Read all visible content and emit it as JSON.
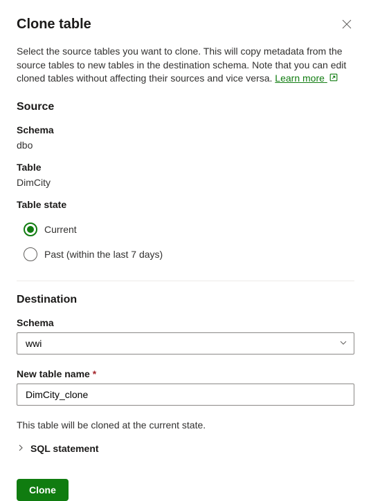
{
  "dialog": {
    "title": "Clone table",
    "description_prefix": "Select the source tables you want to clone. This will copy metadata from the source tables to new tables in the destination schema. Note that you can edit cloned tables without affecting their sources and vice versa. ",
    "learn_more": "Learn more"
  },
  "source": {
    "heading": "Source",
    "schema_label": "Schema",
    "schema_value": "dbo",
    "table_label": "Table",
    "table_value": "DimCity",
    "table_state_label": "Table state",
    "radio_current": "Current",
    "radio_past": "Past (within the last 7 days)"
  },
  "destination": {
    "heading": "Destination",
    "schema_label": "Schema",
    "schema_value": "wwi",
    "new_table_label": "New table name",
    "new_table_value": "DimCity_clone"
  },
  "info_text": "This table will be cloned at the current state.",
  "sql_statement_label": "SQL statement",
  "buttons": {
    "clone": "Clone"
  }
}
